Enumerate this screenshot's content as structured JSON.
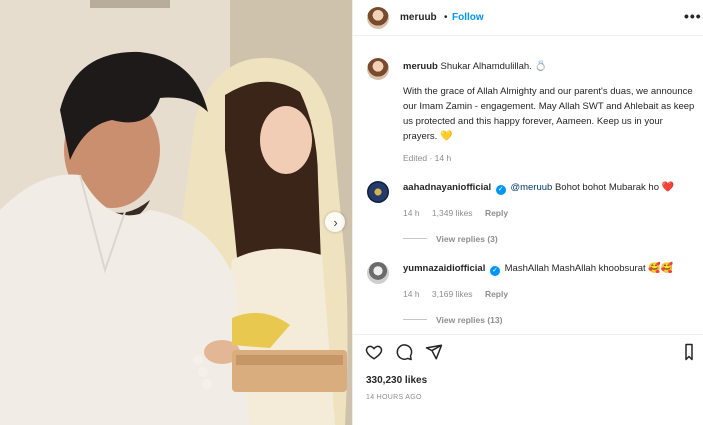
{
  "post": {
    "username": "meruub",
    "follow_label": "Follow",
    "dot": "•",
    "more_icon": "•••",
    "caption_username": "meruub",
    "caption_first": "Shukar Alhamdulillah.",
    "caption_first_emoji": "💍",
    "caption_body": "With the grace of Allah Almighty and our parent's duas, we announce our Imam Zamin - engagement. May Allah SWT and Ahlebait as keep us protected and this happy forever, Aameen. Keep us in your prayers.",
    "caption_body_emoji": "💛",
    "edited": "Edited · 14 h"
  },
  "comments": [
    {
      "username": "aahadnayaniofficial",
      "mention": "@meruub",
      "text": "Bohot bohot Mubarak ho",
      "emoji": "❤️",
      "time": "14 h",
      "likes": "1,349 likes",
      "reply": "Reply",
      "view_replies": "View replies (3)"
    },
    {
      "username": "yumnazaidiofficial",
      "text": "MashAllah MashAllah khoobsurat",
      "emoji": "🥰🥰",
      "time": "14 h",
      "likes": "3,169 likes",
      "reply": "Reply",
      "view_replies": "View replies (13)"
    }
  ],
  "footer": {
    "likes": "330,230 likes",
    "time": "14 HOURS AGO"
  },
  "icons": {
    "verified": "✓",
    "next": "›"
  },
  "colors": {
    "accent": "#0095f6",
    "muted": "#8e8e8e",
    "text": "#262626"
  }
}
